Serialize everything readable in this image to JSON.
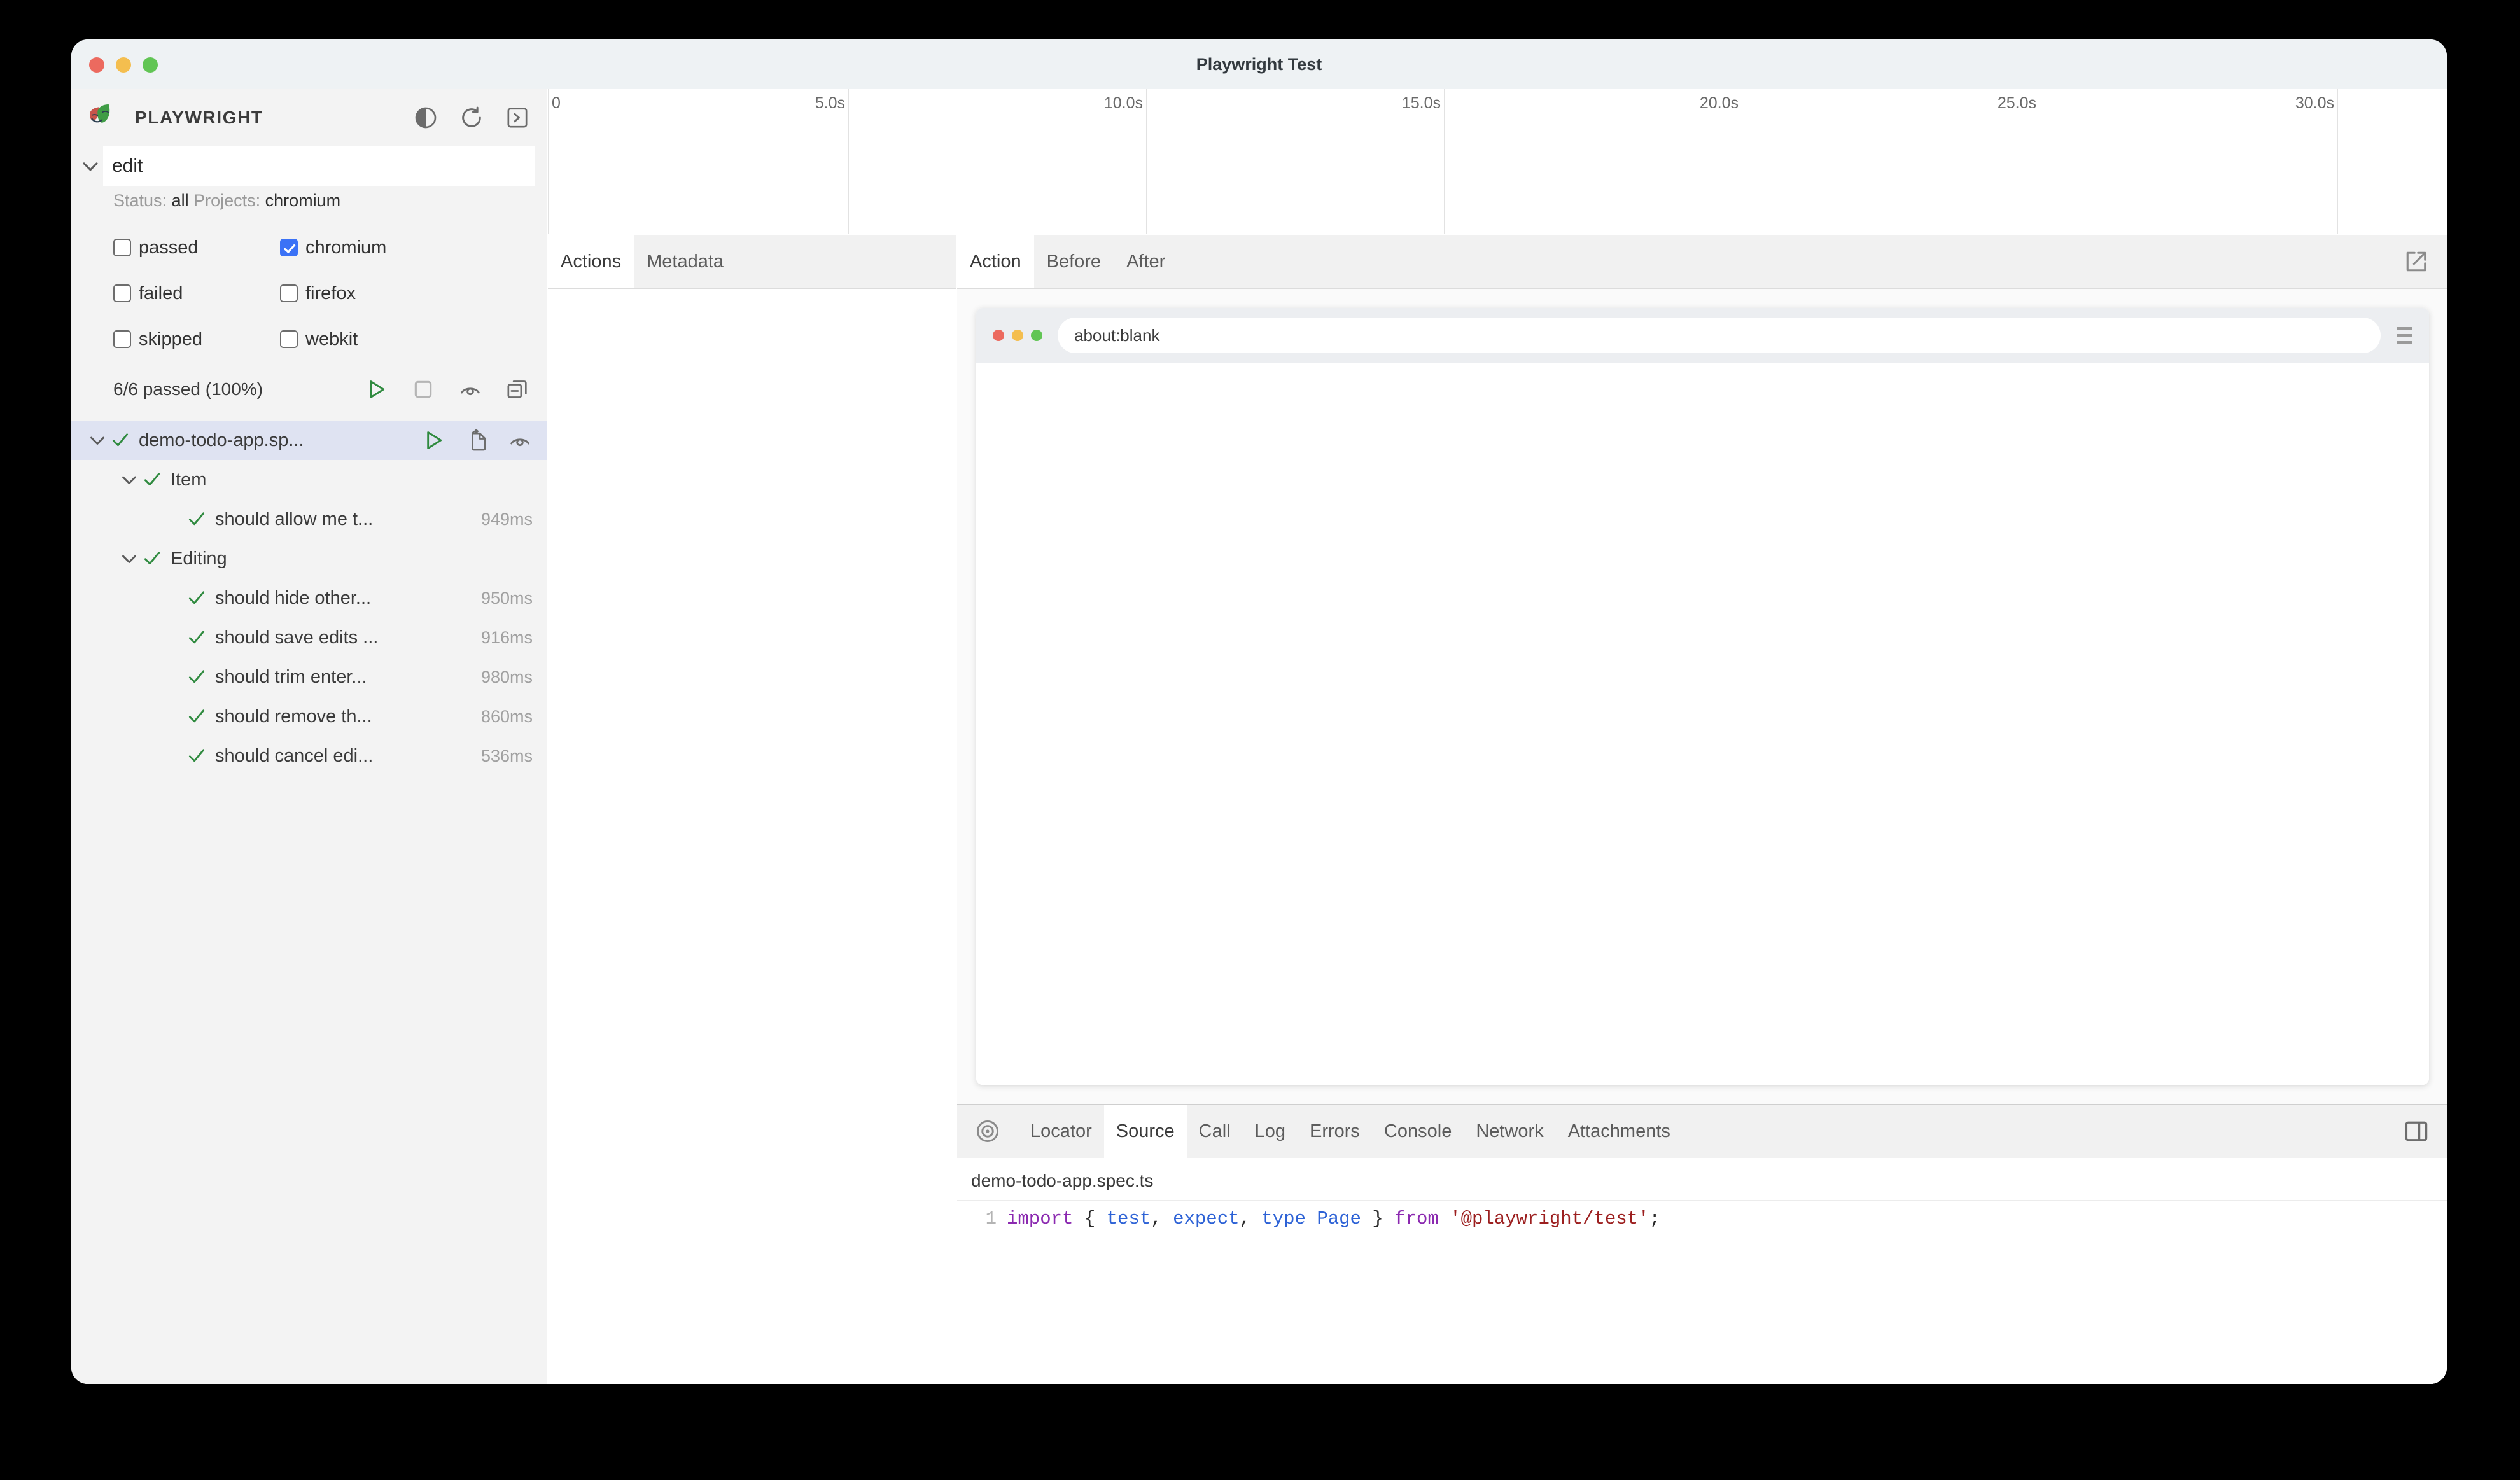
{
  "window": {
    "title": "Playwright Test",
    "traffic_lights": [
      "close-red",
      "minimize-yellow",
      "zoom-green"
    ]
  },
  "sidebar": {
    "brand": "PLAYWRIGHT",
    "header_icons": [
      "theme-toggle-icon",
      "reload-icon",
      "terminal-icon"
    ],
    "search": {
      "value": "edit",
      "placeholder": ""
    },
    "filter_summary": {
      "status_label": "Status:",
      "status_value": "all",
      "projects_label": "Projects:",
      "projects_value": "chromium"
    },
    "status_filters": [
      {
        "label": "passed",
        "checked": false
      },
      {
        "label": "failed",
        "checked": false
      },
      {
        "label": "skipped",
        "checked": false
      }
    ],
    "project_filters": [
      {
        "label": "chromium",
        "checked": true
      },
      {
        "label": "firefox",
        "checked": false
      },
      {
        "label": "webkit",
        "checked": false
      }
    ],
    "status_text": "6/6 passed (100%)",
    "status_icons": [
      "run-icon",
      "stop-icon",
      "watch-eye-icon",
      "collapse-all-icon"
    ],
    "tree": [
      {
        "label": "demo-todo-app.sp...",
        "depth": 0,
        "selected": true,
        "expanded": true,
        "status": "passed",
        "duration": "",
        "icons": [
          "run-icon",
          "copy-file-icon",
          "watch-eye-icon"
        ]
      },
      {
        "label": "Item",
        "depth": 1,
        "selected": false,
        "expanded": true,
        "status": "passed",
        "duration": ""
      },
      {
        "label": "should allow me t...",
        "depth": 2,
        "selected": false,
        "status": "passed",
        "duration": "949ms"
      },
      {
        "label": "Editing",
        "depth": 1,
        "selected": false,
        "expanded": true,
        "status": "passed",
        "duration": ""
      },
      {
        "label": "should hide other...",
        "depth": 2,
        "selected": false,
        "status": "passed",
        "duration": "950ms"
      },
      {
        "label": "should save edits ...",
        "depth": 2,
        "selected": false,
        "status": "passed",
        "duration": "916ms"
      },
      {
        "label": "should trim enter...",
        "depth": 2,
        "selected": false,
        "status": "passed",
        "duration": "980ms"
      },
      {
        "label": "should remove th...",
        "depth": 2,
        "selected": false,
        "status": "passed",
        "duration": "860ms"
      },
      {
        "label": "should cancel edi...",
        "depth": 2,
        "selected": false,
        "status": "passed",
        "duration": "536ms"
      }
    ]
  },
  "timeline": {
    "ticks": [
      "0",
      "5.0s",
      "10.0s",
      "15.0s",
      "20.0s",
      "25.0s",
      "30.0s"
    ]
  },
  "actions_pane": {
    "tabs": [
      {
        "label": "Actions",
        "active": true
      },
      {
        "label": "Metadata",
        "active": false
      }
    ]
  },
  "right_pane": {
    "tabs": [
      {
        "label": "Action",
        "active": true
      },
      {
        "label": "Before",
        "active": false
      },
      {
        "label": "After",
        "active": false
      }
    ],
    "popout_icon": "open-external-icon",
    "snapshot": {
      "url": "about:blank",
      "traffic_lights": [
        "close-red",
        "minimize-yellow",
        "zoom-green"
      ],
      "menu_icon": "hamburger-icon"
    }
  },
  "bottom_pane": {
    "target_icon": "selector-target-icon",
    "tabs": [
      {
        "label": "Locator",
        "active": false
      },
      {
        "label": "Source",
        "active": true
      },
      {
        "label": "Call",
        "active": false
      },
      {
        "label": "Log",
        "active": false
      },
      {
        "label": "Errors",
        "active": false
      },
      {
        "label": "Console",
        "active": false
      },
      {
        "label": "Network",
        "active": false
      },
      {
        "label": "Attachments",
        "active": false
      }
    ],
    "split_icon": "split-pane-icon",
    "file_name": "demo-todo-app.spec.ts",
    "code": [
      {
        "number": "1",
        "tokens": [
          {
            "t": "import",
            "c": "kw"
          },
          {
            "t": " { ",
            "c": "pl"
          },
          {
            "t": "test",
            "c": "id"
          },
          {
            "t": ", ",
            "c": "pl"
          },
          {
            "t": "expect",
            "c": "id"
          },
          {
            "t": ", ",
            "c": "pl"
          },
          {
            "t": "type",
            "c": "id"
          },
          {
            "t": " ",
            "c": "pl"
          },
          {
            "t": "Page",
            "c": "id"
          },
          {
            "t": " } ",
            "c": "pl"
          },
          {
            "t": "from",
            "c": "kw"
          },
          {
            "t": " ",
            "c": "pl"
          },
          {
            "t": "'@playwright/test'",
            "c": "str"
          },
          {
            "t": ";",
            "c": "pl"
          }
        ]
      }
    ]
  },
  "colors": {
    "accent_blue": "#3b72f6",
    "pass_green": "#2f8a3f",
    "selection": "#dfe3f2",
    "chrome_bg": "#f3f3f3"
  }
}
